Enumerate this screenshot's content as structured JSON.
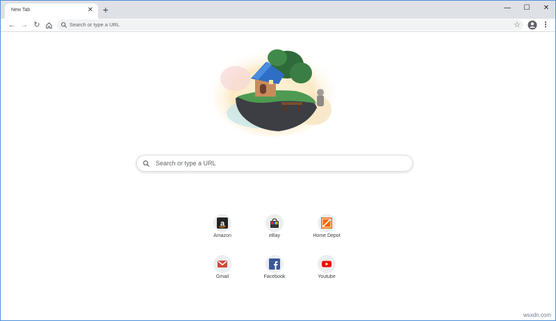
{
  "tab": {
    "title": "New Tab"
  },
  "omnibox": {
    "placeholder": "Search or type a URL"
  },
  "search": {
    "placeholder": "Search or type a URL"
  },
  "shortcuts": [
    {
      "label": "Amazon",
      "icon": "amazon-icon",
      "color": "#222222"
    },
    {
      "label": "eBay",
      "icon": "ebay-icon",
      "color": "#e53238"
    },
    {
      "label": "Home Depot",
      "icon": "home-depot-icon",
      "color": "#f96302"
    },
    {
      "label": "Gmail",
      "icon": "gmail-icon",
      "color": "#c5221f"
    },
    {
      "label": "Facebook",
      "icon": "facebook-icon",
      "color": "#3b5998"
    },
    {
      "label": "Youtube",
      "icon": "youtube-icon",
      "color": "#ff0000"
    }
  ],
  "watermark": "wsxdn.com",
  "colors": {
    "frame": "#4a8ed8",
    "tabstrip": "#dee1e6",
    "omnibox_bg": "#f1f3f4"
  }
}
